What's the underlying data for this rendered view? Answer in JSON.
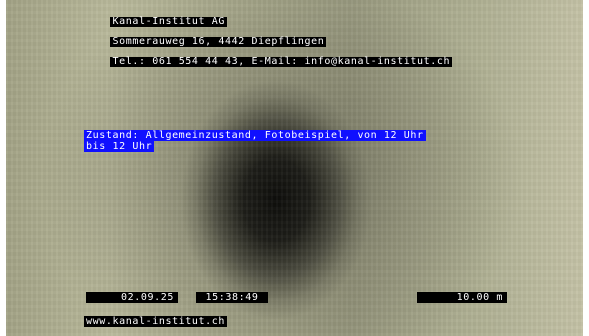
{
  "header": {
    "line1": "Kanal-Institut AG",
    "line2": "Sommerauweg 16, 4442 Diepflingen",
    "line3": "Tel.: 061 554 44 43, E-Mail: info@kanal-institut.ch"
  },
  "status": {
    "line1": "Zustand: Allgemeinzustand, Fotobeispiel, von 12 Uhr",
    "line2": "bis 12 Uhr",
    "background_color": "#1010ff"
  },
  "footer": {
    "date": "02.09.25",
    "time": "15:38:49",
    "distance": "10.00 m",
    "website": "www.kanal-institut.ch"
  }
}
